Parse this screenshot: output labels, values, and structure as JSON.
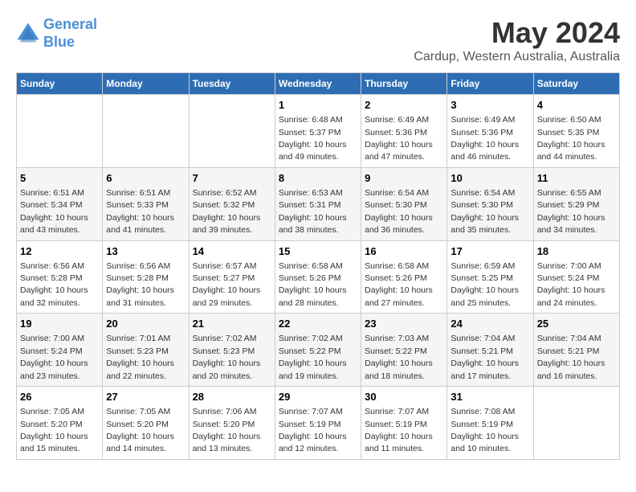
{
  "logo": {
    "line1": "General",
    "line2": "Blue"
  },
  "title": "May 2024",
  "subtitle": "Cardup, Western Australia, Australia",
  "days_of_week": [
    "Sunday",
    "Monday",
    "Tuesday",
    "Wednesday",
    "Thursday",
    "Friday",
    "Saturday"
  ],
  "weeks": [
    [
      {
        "day": "",
        "info": ""
      },
      {
        "day": "",
        "info": ""
      },
      {
        "day": "",
        "info": ""
      },
      {
        "day": "1",
        "info": "Sunrise: 6:48 AM\nSunset: 5:37 PM\nDaylight: 10 hours\nand 49 minutes."
      },
      {
        "day": "2",
        "info": "Sunrise: 6:49 AM\nSunset: 5:36 PM\nDaylight: 10 hours\nand 47 minutes."
      },
      {
        "day": "3",
        "info": "Sunrise: 6:49 AM\nSunset: 5:36 PM\nDaylight: 10 hours\nand 46 minutes."
      },
      {
        "day": "4",
        "info": "Sunrise: 6:50 AM\nSunset: 5:35 PM\nDaylight: 10 hours\nand 44 minutes."
      }
    ],
    [
      {
        "day": "5",
        "info": "Sunrise: 6:51 AM\nSunset: 5:34 PM\nDaylight: 10 hours\nand 43 minutes."
      },
      {
        "day": "6",
        "info": "Sunrise: 6:51 AM\nSunset: 5:33 PM\nDaylight: 10 hours\nand 41 minutes."
      },
      {
        "day": "7",
        "info": "Sunrise: 6:52 AM\nSunset: 5:32 PM\nDaylight: 10 hours\nand 39 minutes."
      },
      {
        "day": "8",
        "info": "Sunrise: 6:53 AM\nSunset: 5:31 PM\nDaylight: 10 hours\nand 38 minutes."
      },
      {
        "day": "9",
        "info": "Sunrise: 6:54 AM\nSunset: 5:30 PM\nDaylight: 10 hours\nand 36 minutes."
      },
      {
        "day": "10",
        "info": "Sunrise: 6:54 AM\nSunset: 5:30 PM\nDaylight: 10 hours\nand 35 minutes."
      },
      {
        "day": "11",
        "info": "Sunrise: 6:55 AM\nSunset: 5:29 PM\nDaylight: 10 hours\nand 34 minutes."
      }
    ],
    [
      {
        "day": "12",
        "info": "Sunrise: 6:56 AM\nSunset: 5:28 PM\nDaylight: 10 hours\nand 32 minutes."
      },
      {
        "day": "13",
        "info": "Sunrise: 6:56 AM\nSunset: 5:28 PM\nDaylight: 10 hours\nand 31 minutes."
      },
      {
        "day": "14",
        "info": "Sunrise: 6:57 AM\nSunset: 5:27 PM\nDaylight: 10 hours\nand 29 minutes."
      },
      {
        "day": "15",
        "info": "Sunrise: 6:58 AM\nSunset: 5:26 PM\nDaylight: 10 hours\nand 28 minutes."
      },
      {
        "day": "16",
        "info": "Sunrise: 6:58 AM\nSunset: 5:26 PM\nDaylight: 10 hours\nand 27 minutes."
      },
      {
        "day": "17",
        "info": "Sunrise: 6:59 AM\nSunset: 5:25 PM\nDaylight: 10 hours\nand 25 minutes."
      },
      {
        "day": "18",
        "info": "Sunrise: 7:00 AM\nSunset: 5:24 PM\nDaylight: 10 hours\nand 24 minutes."
      }
    ],
    [
      {
        "day": "19",
        "info": "Sunrise: 7:00 AM\nSunset: 5:24 PM\nDaylight: 10 hours\nand 23 minutes."
      },
      {
        "day": "20",
        "info": "Sunrise: 7:01 AM\nSunset: 5:23 PM\nDaylight: 10 hours\nand 22 minutes."
      },
      {
        "day": "21",
        "info": "Sunrise: 7:02 AM\nSunset: 5:23 PM\nDaylight: 10 hours\nand 20 minutes."
      },
      {
        "day": "22",
        "info": "Sunrise: 7:02 AM\nSunset: 5:22 PM\nDaylight: 10 hours\nand 19 minutes."
      },
      {
        "day": "23",
        "info": "Sunrise: 7:03 AM\nSunset: 5:22 PM\nDaylight: 10 hours\nand 18 minutes."
      },
      {
        "day": "24",
        "info": "Sunrise: 7:04 AM\nSunset: 5:21 PM\nDaylight: 10 hours\nand 17 minutes."
      },
      {
        "day": "25",
        "info": "Sunrise: 7:04 AM\nSunset: 5:21 PM\nDaylight: 10 hours\nand 16 minutes."
      }
    ],
    [
      {
        "day": "26",
        "info": "Sunrise: 7:05 AM\nSunset: 5:20 PM\nDaylight: 10 hours\nand 15 minutes."
      },
      {
        "day": "27",
        "info": "Sunrise: 7:05 AM\nSunset: 5:20 PM\nDaylight: 10 hours\nand 14 minutes."
      },
      {
        "day": "28",
        "info": "Sunrise: 7:06 AM\nSunset: 5:20 PM\nDaylight: 10 hours\nand 13 minutes."
      },
      {
        "day": "29",
        "info": "Sunrise: 7:07 AM\nSunset: 5:19 PM\nDaylight: 10 hours\nand 12 minutes."
      },
      {
        "day": "30",
        "info": "Sunrise: 7:07 AM\nSunset: 5:19 PM\nDaylight: 10 hours\nand 11 minutes."
      },
      {
        "day": "31",
        "info": "Sunrise: 7:08 AM\nSunset: 5:19 PM\nDaylight: 10 hours\nand 10 minutes."
      },
      {
        "day": "",
        "info": ""
      }
    ]
  ]
}
